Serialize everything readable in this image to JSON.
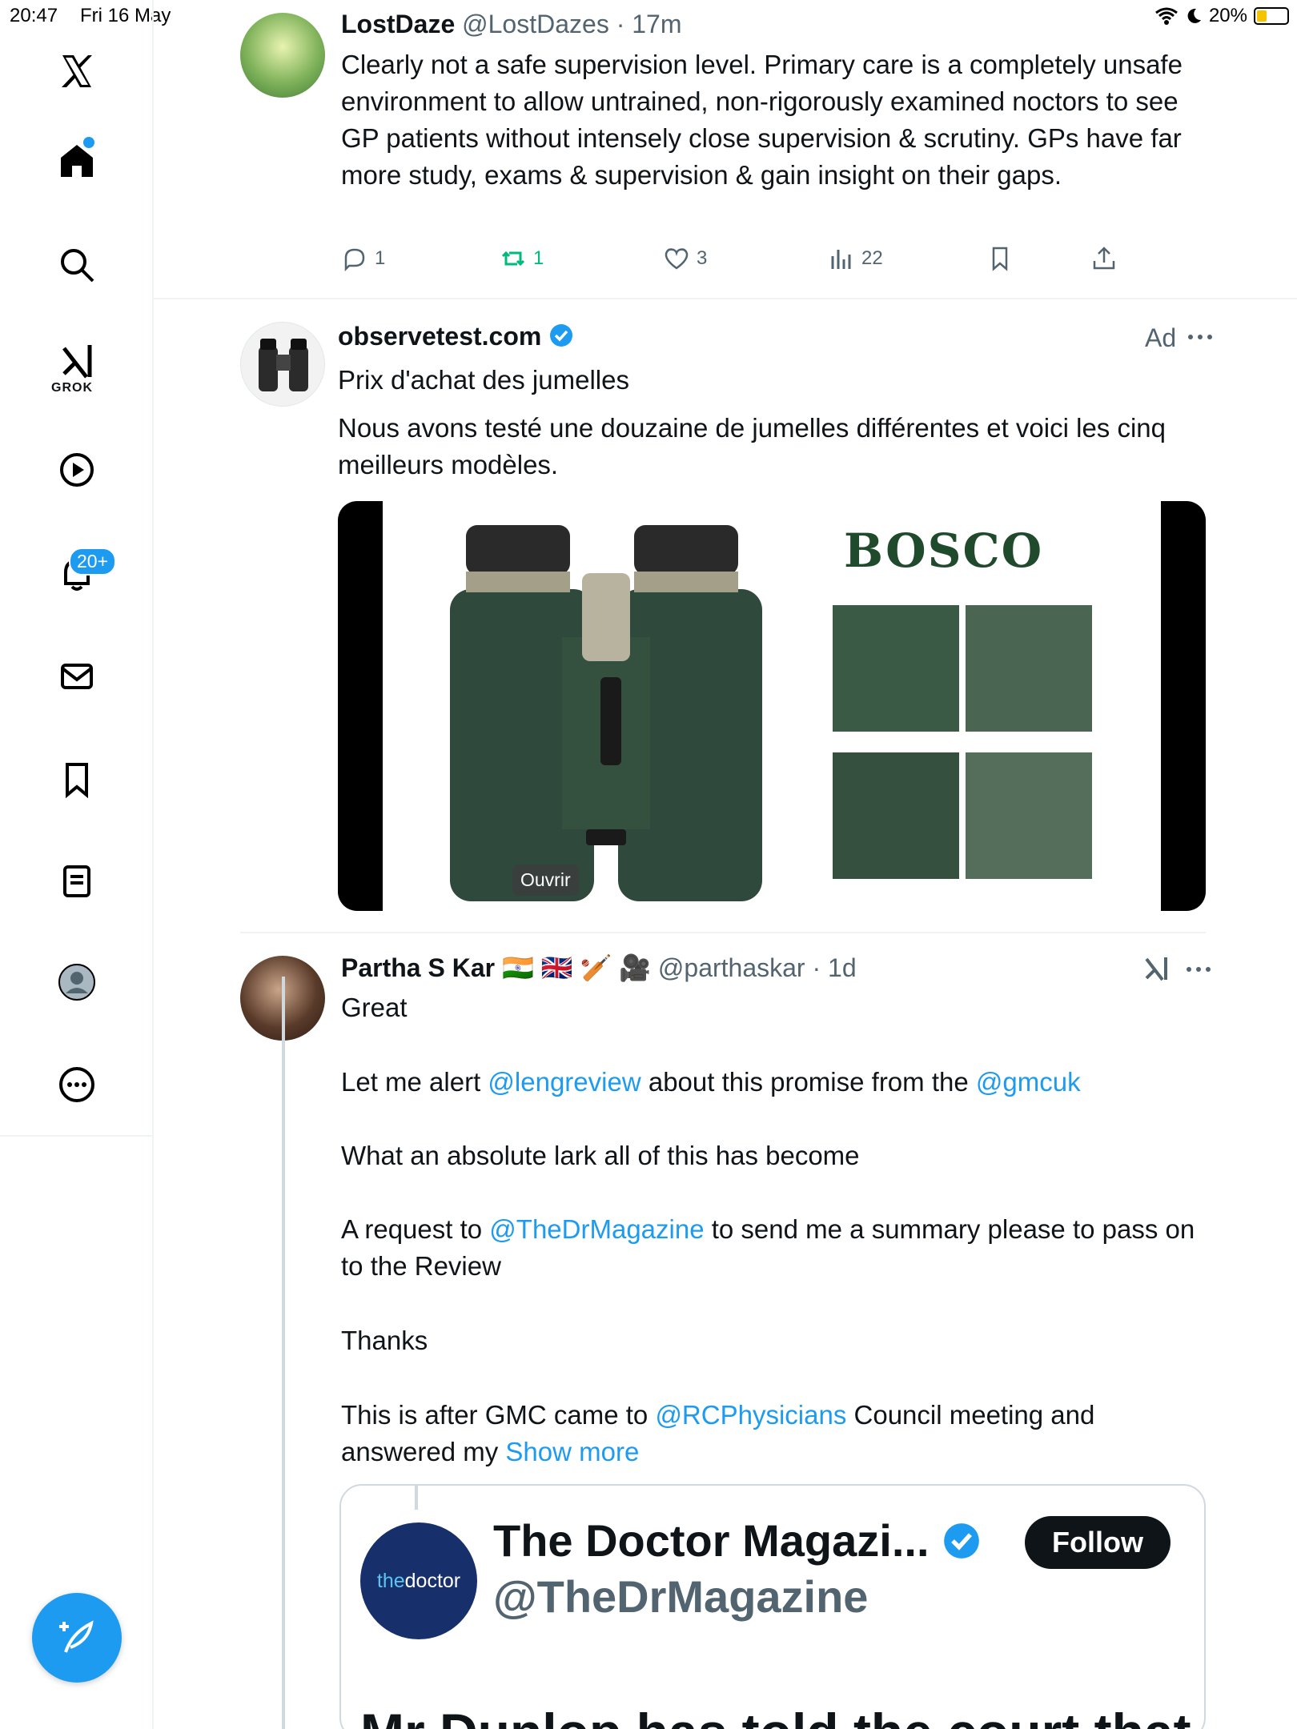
{
  "status_bar": {
    "time": "20:47",
    "date": "Fri 16 May",
    "battery": "20%"
  },
  "sidebar": {
    "grok_label": "GROK",
    "notification_badge": "20+"
  },
  "tweet1": {
    "name": "LostDaze",
    "handle": "@LostDazes",
    "time": "· 17m",
    "text": "Clearly not a safe supervision level. Primary care is a completely unsafe environment to allow untrained, non-rigorously examined noctors to see GP patients without intensely close supervision & scrutiny. GPs have far more study, exams & supervision & gain insight on their gaps.",
    "replies": "1",
    "reposts": "1",
    "likes": "3",
    "views": "22"
  },
  "ad": {
    "name": "observetest.com",
    "label": "Ad",
    "title": "Prix d'achat des jumelles",
    "text": "Nous avons testé une douzaine de jumelles différentes et voici les cinq meilleurs modèles.",
    "brand": "BOSCO",
    "open_label": "Ouvrir"
  },
  "tweet2": {
    "name": "Partha S Kar",
    "emojis": "🇮🇳 🇬🇧 🏏 🎥",
    "handle": "@parthaskar",
    "time": "· 1d",
    "p1": "Great",
    "p2_a": "Let me alert ",
    "p2_m1": "@lengreview",
    "p2_b": " about this promise from the ",
    "p2_m2": "@gmcuk",
    "p3": "What an absolute lark all of this has become",
    "p4_a": "A request to ",
    "p4_m": "@TheDrMagazine",
    "p4_b": " to send me a summary please to pass on to the Review",
    "p5": "Thanks",
    "p6_a": "This is after GMC came to ",
    "p6_m": "@RCPhysicians",
    "p6_b": " Council meeting and answered my ",
    "show_more": "Show more"
  },
  "quote": {
    "name": "The Doctor Magazi...",
    "handle": "@TheDrMagazine",
    "follow": "Follow",
    "logo_text_a": "the",
    "logo_text_b": "doctor",
    "headline": "Mr Dunlop has told the court that"
  }
}
